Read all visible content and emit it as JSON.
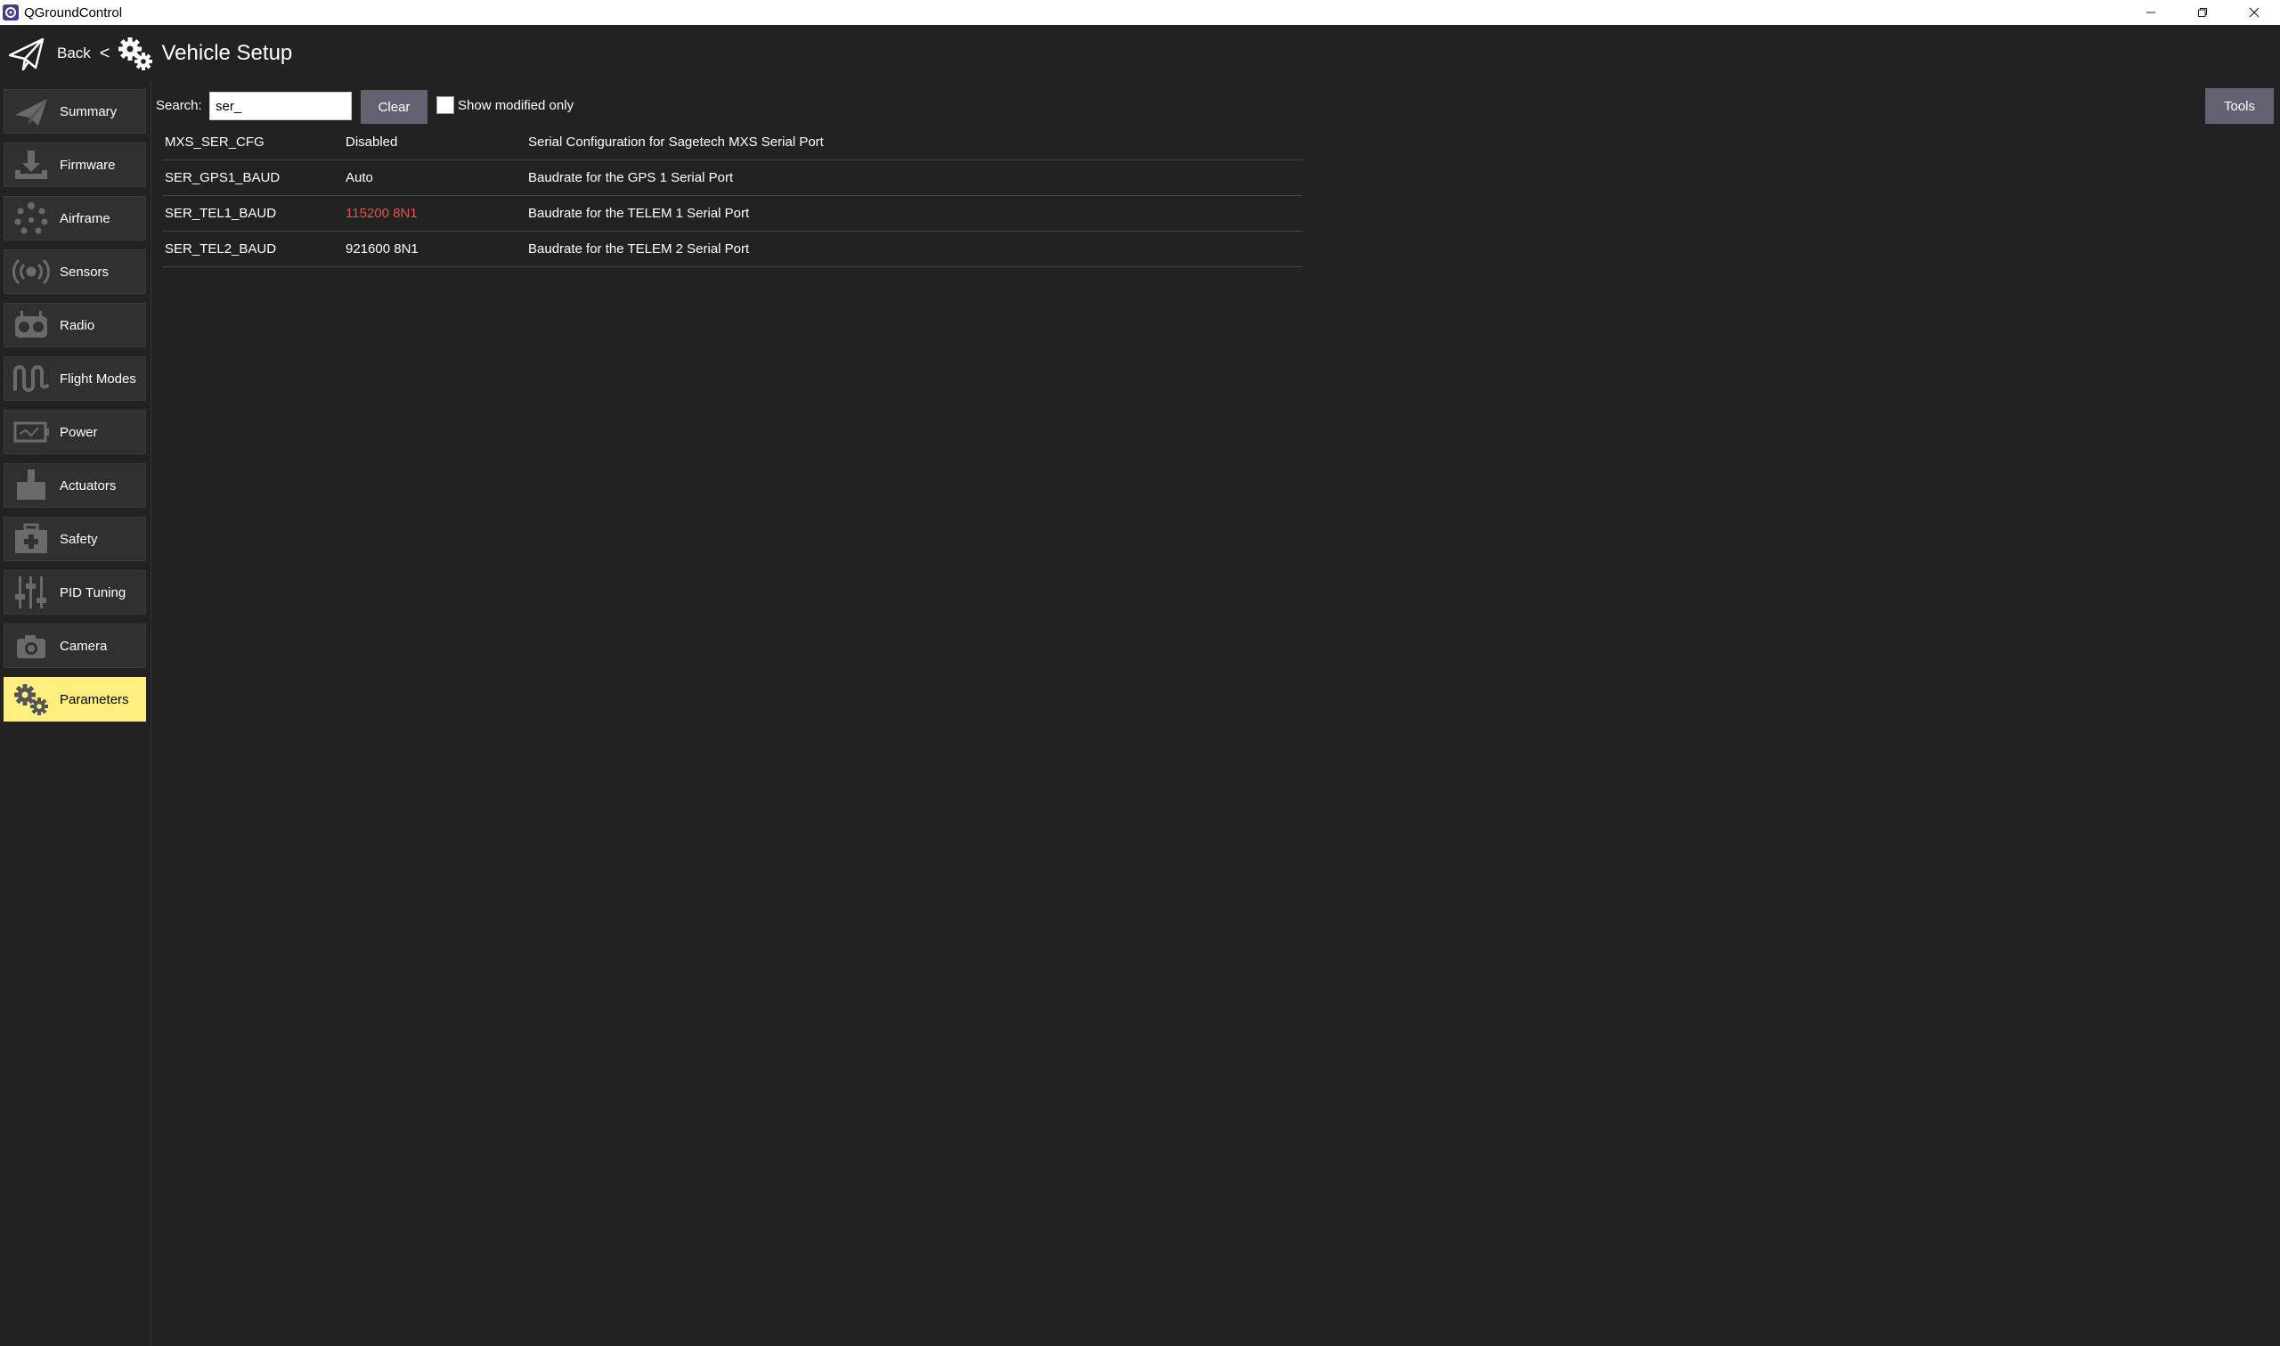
{
  "window": {
    "title": "QGroundControl"
  },
  "header": {
    "back_label": "Back",
    "separator": "<",
    "title": "Vehicle Setup"
  },
  "sidebar": {
    "items": [
      {
        "label": "Summary",
        "icon": "paper-plane-icon"
      },
      {
        "label": "Firmware",
        "icon": "download-icon"
      },
      {
        "label": "Airframe",
        "icon": "airframe-dots-icon"
      },
      {
        "label": "Sensors",
        "icon": "sensors-icon"
      },
      {
        "label": "Radio",
        "icon": "radio-icon"
      },
      {
        "label": "Flight Modes",
        "icon": "flight-modes-wave-icon"
      },
      {
        "label": "Power",
        "icon": "battery-icon"
      },
      {
        "label": "Actuators",
        "icon": "actuator-icon"
      },
      {
        "label": "Safety",
        "icon": "first-aid-icon"
      },
      {
        "label": "PID Tuning",
        "icon": "sliders-icon"
      },
      {
        "label": "Camera",
        "icon": "camera-icon"
      },
      {
        "label": "Parameters",
        "icon": "gears-icon",
        "active": true
      }
    ]
  },
  "search": {
    "label": "Search:",
    "value": "ser_",
    "clear_label": "Clear",
    "modified_only_label": "Show modified only",
    "modified_only_checked": false
  },
  "tools_label": "Tools",
  "parameters": {
    "rows": [
      {
        "name": "MXS_SER_CFG",
        "value": "Disabled",
        "description": "Serial Configuration for Sagetech MXS Serial Port",
        "modified": false
      },
      {
        "name": "SER_GPS1_BAUD",
        "value": "Auto",
        "description": "Baudrate for the GPS 1 Serial Port",
        "modified": false
      },
      {
        "name": "SER_TEL1_BAUD",
        "value": "115200 8N1",
        "description": "Baudrate for the TELEM 1 Serial Port",
        "modified": true
      },
      {
        "name": "SER_TEL2_BAUD",
        "value": "921600 8N1",
        "description": "Baudrate for the TELEM 2 Serial Port",
        "modified": false
      }
    ]
  },
  "colors": {
    "background": "#222222",
    "active_item": "#ffef7f",
    "button": "#626270",
    "modified_value": "#e0524f"
  }
}
